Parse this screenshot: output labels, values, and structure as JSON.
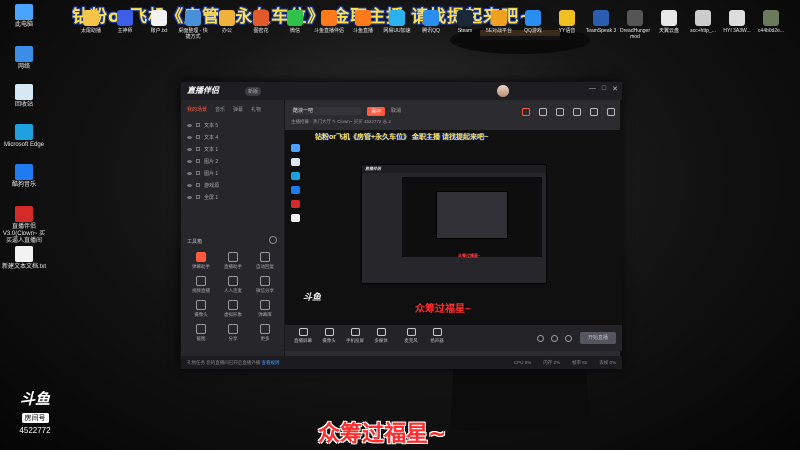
{
  "banner": "钻粉or飞机《房管+永久车位》 金职主播 请找提起来吧~",
  "desktop_left": [
    {
      "label": "此电脑",
      "color": "#4aa3ff"
    },
    {
      "label": "网络",
      "color": "#3c8de6"
    },
    {
      "label": "回收站",
      "color": "#d8e8f5"
    },
    {
      "label": "Microsoft Edge",
      "color": "#1fa0e0"
    },
    {
      "label": "酷狗音乐",
      "color": "#1f7cf0"
    },
    {
      "label": "直播伴侣V3.0(Clown~ 买买逼人直播间",
      "color": "#d42a2a"
    },
    {
      "label": "新建文本文档.txt",
      "color": "#f2f2f2"
    }
  ],
  "desktop_top": [
    {
      "label": "太尾助播",
      "color": "#f5c54a"
    },
    {
      "label": "主神师",
      "color": "#3c5ee8"
    },
    {
      "label": "账户.txt",
      "color": "#f2f2f2"
    },
    {
      "label": "桌面整理 - 快捷方式",
      "color": "#4a90d9"
    },
    {
      "label": "办公",
      "color": "#f0b23a"
    },
    {
      "label": "图密花",
      "color": "#e05a2a"
    },
    {
      "label": "微信",
      "color": "#2ec24a"
    },
    {
      "label": "斗鱼直播伴侣",
      "color": "#ff7a1a"
    },
    {
      "label": "斗鱼直播",
      "color": "#ff7a1a"
    },
    {
      "label": "网易UU加速",
      "color": "#2bb0f0"
    },
    {
      "label": "腾讯QQ",
      "color": "#2a8ef0"
    },
    {
      "label": "Steam",
      "color": "#1b2838"
    },
    {
      "label": "5E对战平台",
      "color": "#f0a020"
    },
    {
      "label": "QQ游戏",
      "color": "#2a8ef0"
    },
    {
      "label": "YY语音",
      "color": "#f0c020"
    },
    {
      "label": "TeamSpeak 3",
      "color": "#2a5db0"
    },
    {
      "label": "DreadHunger mod",
      "color": "#555555"
    },
    {
      "label": "天翼云盘",
      "color": "#e8e8e8"
    },
    {
      "label": "scc+http_...",
      "color": "#cccccc"
    },
    {
      "label": "HYI 3A3W...",
      "color": "#dddddd"
    },
    {
      "label": "c44b0d2e...",
      "color": "#6b7a5a"
    }
  ],
  "app": {
    "logo": "直播伴侣",
    "version": "新版",
    "window_controls": [
      "—",
      "□",
      "✕"
    ],
    "left_tabs": [
      "我的场景",
      "音乐",
      "弹幕",
      "礼物"
    ],
    "scenes": [
      "文本 5",
      "文本 4",
      "文本 1",
      "图片 2",
      "图片 1",
      "游戏源",
      "全屏 1"
    ],
    "tools_title": "工具箱",
    "tools": [
      "弹幕助手",
      "直播助手",
      "自动回复",
      "视频直播",
      "人人连麦",
      "微信分享",
      "摄像头",
      "虚拟形象",
      "弹幕库",
      "截图",
      "分享",
      "更多"
    ],
    "room_title": "酷浪一吧",
    "save_label": "保存",
    "cancel_label": "取消",
    "meta": "主播招募 · 热门大厅 ✎   Clown~ 买买   4522772   ♨ 2",
    "preview_banner": "钻粉or飞机《房管+永久车位》 金职主播 请找提起来吧~",
    "nested_title": "直播伴侣",
    "nested_caption": "众筹过福星~",
    "preview_caption": "众筹过福星~",
    "preview_logo": "斗鱼",
    "bottom_tools": [
      "直播屏幕",
      "摄像头",
      "手机投屏",
      "多媒体",
      "麦克风",
      "扬声器"
    ],
    "live_button": "开始直播",
    "status_notice": "礼物任务   您的直播间已开启直播外播  ",
    "status_link": "查看规则",
    "status_stats": [
      "CPU 8%",
      "内存 2%",
      "帧率 60",
      "丢帧 0%"
    ]
  },
  "douyu": {
    "logo": "斗鱼",
    "tag": "房间号",
    "room_id": "4522772"
  },
  "caption": "众筹过福星~"
}
